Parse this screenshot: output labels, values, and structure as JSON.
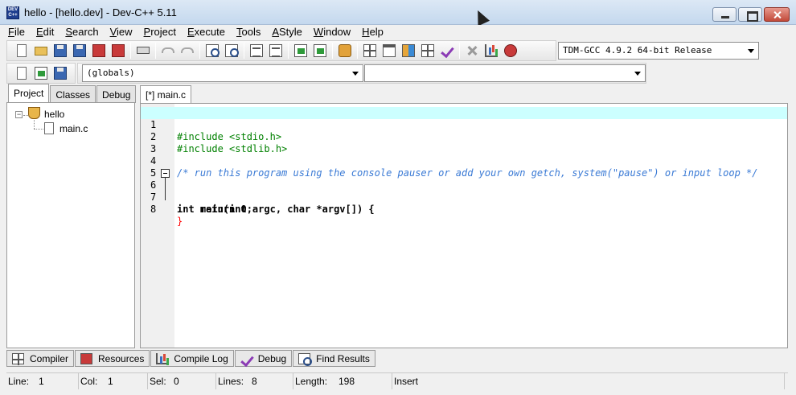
{
  "window": {
    "title": "hello - [hello.dev] - Dev-C++ 5.11",
    "icon": "dev-cpp-icon",
    "icon_text": "DEV C++"
  },
  "menu": [
    {
      "key": "F",
      "rest": "ile"
    },
    {
      "key": "E",
      "rest": "dit"
    },
    {
      "key": "S",
      "rest": "earch"
    },
    {
      "key": "V",
      "rest": "iew"
    },
    {
      "key": "P",
      "rest": "roject"
    },
    {
      "key": "E",
      "rest": "xecute"
    },
    {
      "key": "T",
      "rest": "ools"
    },
    {
      "key": "A",
      "rest": "Style"
    },
    {
      "key": "W",
      "rest": "indow"
    },
    {
      "key": "H",
      "rest": "elp"
    }
  ],
  "toolbar": {
    "compiler_selected": "TDM-GCC 4.9.2 64-bit Release",
    "globals_selected": "(globals)",
    "member_selected": ""
  },
  "left_panel": {
    "tabs": [
      "Project",
      "Classes",
      "Debug"
    ],
    "active_tab": "Project",
    "tree": {
      "project": "hello",
      "files": [
        "main.c"
      ]
    }
  },
  "editor": {
    "tab_label": "[*] main.c",
    "lines": [
      {
        "n": "1",
        "text": "#include <stdio.h>"
      },
      {
        "n": "2",
        "text": "#include <stdlib.h>"
      },
      {
        "n": "3",
        "text": ""
      },
      {
        "n": "4",
        "text": "/* run this program using the console pauser or add your own getch, system(\"pause\") or input loop */"
      },
      {
        "n": "5",
        "text": ""
      },
      {
        "n": "6",
        "text": "int main(int argc, char *argv[]) {"
      },
      {
        "n": "7",
        "text": "    return 0;"
      },
      {
        "n": "8",
        "text": "}"
      }
    ],
    "current_line_color": "#ccffff"
  },
  "bottom_tabs": [
    {
      "label": "Compiler",
      "icon": "compiler-grid-icon"
    },
    {
      "label": "Resources",
      "icon": "resources-icon"
    },
    {
      "label": "Compile Log",
      "icon": "compile-log-chart-icon"
    },
    {
      "label": "Debug",
      "icon": "debug-check-icon"
    },
    {
      "label": "Find Results",
      "icon": "find-results-icon"
    }
  ],
  "status": {
    "line_label": "Line:",
    "line_value": "1",
    "col_label": "Col:",
    "col_value": "1",
    "sel_label": "Sel:",
    "sel_value": "0",
    "lines_label": "Lines:",
    "lines_value": "8",
    "length_label": "Length:",
    "length_value": "198",
    "mode": "Insert"
  }
}
